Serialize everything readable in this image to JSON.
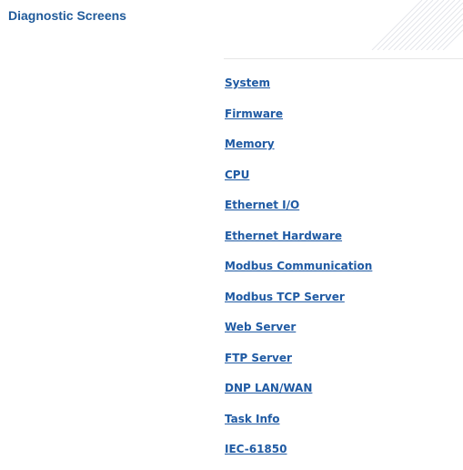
{
  "header": {
    "title": "Diagnostic Screens"
  },
  "nav": {
    "items": [
      {
        "label": "System"
      },
      {
        "label": "Firmware"
      },
      {
        "label": "Memory"
      },
      {
        "label": "CPU"
      },
      {
        "label": "Ethernet I/O"
      },
      {
        "label": "Ethernet Hardware"
      },
      {
        "label": "Modbus Communication"
      },
      {
        "label": "Modbus TCP Server"
      },
      {
        "label": "Web Server"
      },
      {
        "label": "FTP Server"
      },
      {
        "label": "DNP LAN/WAN"
      },
      {
        "label": "Task Info"
      },
      {
        "label": "IEC-61850"
      }
    ]
  },
  "colors": {
    "title": "#1f5a9a",
    "link": "#1f5aa3",
    "divider": "#e6e6e6"
  }
}
